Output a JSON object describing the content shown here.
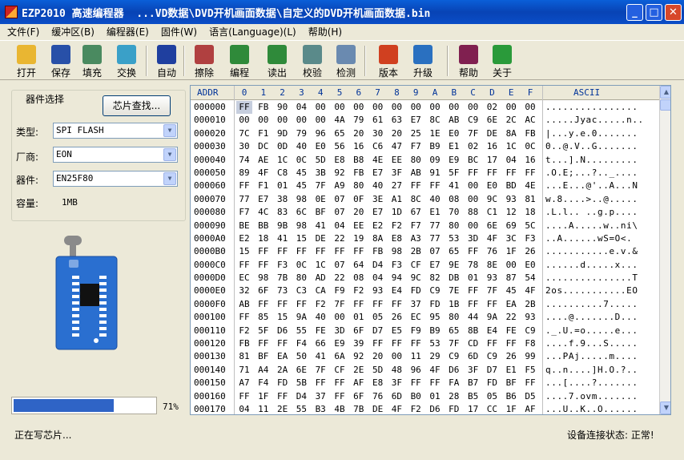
{
  "window": {
    "title": "EZP2010 高速编程器  ...VD数据\\DVD开机画面数据\\自定义的DVD开机画面数据.bin",
    "min": "_",
    "max": "□",
    "close": "✕"
  },
  "menu": [
    "文件(F)",
    "缓冲区(B)",
    "编程器(E)",
    "固件(W)",
    "语言(Language)(L)",
    "帮助(H)"
  ],
  "toolbar": {
    "items": [
      {
        "label": "打开",
        "icon": "open-folder-icon",
        "color": "#e9b632"
      },
      {
        "label": "保存",
        "icon": "floppy-save-icon",
        "color": "#2850a8"
      },
      {
        "label": "填充",
        "icon": "fill-icon",
        "color": "#4a8a60"
      },
      {
        "label": "交换",
        "icon": "swap-icon",
        "color": "#3aa0c8"
      },
      {
        "label": "自动",
        "icon": "auto-icon",
        "color": "#1f3f9f"
      },
      {
        "label": "擦除",
        "icon": "erase-icon",
        "color": "#b04040"
      },
      {
        "label": "编程",
        "icon": "program-icon",
        "color": "#2f8a3a"
      },
      {
        "label": "读出",
        "icon": "read-icon",
        "color": "#2f8a3a"
      },
      {
        "label": "校验",
        "icon": "verify-icon",
        "color": "#5a8a8a"
      },
      {
        "label": "检测",
        "icon": "detect-icon",
        "color": "#6a8ab0"
      },
      {
        "label": "版本",
        "icon": "version-icon",
        "color": "#d04020"
      },
      {
        "label": "升级",
        "icon": "upgrade-icon",
        "color": "#2a70c0"
      },
      {
        "label": "帮助",
        "icon": "help-book-icon",
        "color": "#802050"
      },
      {
        "label": "关于",
        "icon": "info-icon",
        "color": "#2a9a3a"
      }
    ]
  },
  "device": {
    "group_title": "器件选择",
    "find_chip": "芯片查找...",
    "type_label": "类型:",
    "type_value": "SPI FLASH",
    "vendor_label": "厂商:",
    "vendor_value": "EON",
    "chip_label": "器件:",
    "chip_value": "EN25F80",
    "capacity_label": "容量:",
    "capacity_value": "1MB"
  },
  "progress": {
    "value": 0.71,
    "text": "71%"
  },
  "hex": {
    "addr_header": "ADDR",
    "col_headers": [
      "0",
      "1",
      "2",
      "3",
      "4",
      "5",
      "6",
      "7",
      "8",
      "9",
      "A",
      "B",
      "C",
      "D",
      "E",
      "F"
    ],
    "ascii_header": "ASCII",
    "rows": [
      {
        "addr": "000000",
        "bytes": [
          "FF",
          "FB",
          "90",
          "04",
          "00",
          "00",
          "00",
          "00",
          "00",
          "00",
          "00",
          "00",
          "00",
          "02",
          "00",
          "00"
        ],
        "ascii": "................"
      },
      {
        "addr": "000010",
        "bytes": [
          "00",
          "00",
          "00",
          "00",
          "00",
          "4A",
          "79",
          "61",
          "63",
          "E7",
          "8C",
          "AB",
          "C9",
          "6E",
          "2C",
          "AC"
        ],
        "ascii": ".....Jyac.....n.."
      },
      {
        "addr": "000020",
        "bytes": [
          "7C",
          "F1",
          "9D",
          "79",
          "96",
          "65",
          "20",
          "30",
          "20",
          "25",
          "1E",
          "E0",
          "7F",
          "DE",
          "8A",
          "FB"
        ],
        "ascii": "|...y.e.0......."
      },
      {
        "addr": "000030",
        "bytes": [
          "30",
          "DC",
          "0D",
          "40",
          "E0",
          "56",
          "16",
          "C6",
          "47",
          "F7",
          "B9",
          "E1",
          "02",
          "16",
          "1C",
          "0C"
        ],
        "ascii": "0..@.V..G......."
      },
      {
        "addr": "000040",
        "bytes": [
          "74",
          "AE",
          "1C",
          "0C",
          "5D",
          "E8",
          "B8",
          "4E",
          "EE",
          "80",
          "09",
          "E9",
          "BC",
          "17",
          "04",
          "16"
        ],
        "ascii": "t...].N........."
      },
      {
        "addr": "000050",
        "bytes": [
          "89",
          "4F",
          "C8",
          "45",
          "3B",
          "92",
          "FB",
          "E7",
          "3F",
          "AB",
          "91",
          "5F",
          "FF",
          "FF",
          "FF",
          "FF"
        ],
        "ascii": ".O.E;...?.._...."
      },
      {
        "addr": "000060",
        "bytes": [
          "FF",
          "F1",
          "01",
          "45",
          "7F",
          "A9",
          "80",
          "40",
          "27",
          "FF",
          "FF",
          "41",
          "00",
          "E0",
          "BD",
          "4E"
        ],
        "ascii": "...E...@'..A...N"
      },
      {
        "addr": "000070",
        "bytes": [
          "77",
          "E7",
          "38",
          "98",
          "0E",
          "07",
          "0F",
          "3E",
          "A1",
          "8C",
          "40",
          "08",
          "00",
          "9C",
          "93",
          "81"
        ],
        "ascii": "w.8....>..@....."
      },
      {
        "addr": "000080",
        "bytes": [
          "F7",
          "4C",
          "83",
          "6C",
          "BF",
          "07",
          "20",
          "E7",
          "1D",
          "67",
          "E1",
          "70",
          "88",
          "C1",
          "12",
          "18"
        ],
        "ascii": ".L.l.. ..g.p...."
      },
      {
        "addr": "000090",
        "bytes": [
          "BE",
          "BB",
          "9B",
          "98",
          "41",
          "04",
          "EE",
          "E2",
          "F2",
          "F7",
          "77",
          "80",
          "00",
          "6E",
          "69",
          "5C"
        ],
        "ascii": "....A.....w..ni\\"
      },
      {
        "addr": "0000A0",
        "bytes": [
          "E2",
          "18",
          "41",
          "15",
          "DE",
          "22",
          "19",
          "8A",
          "E8",
          "A3",
          "77",
          "53",
          "3D",
          "4F",
          "3C",
          "F3"
        ],
        "ascii": "..A......wS=O<."
      },
      {
        "addr": "0000B0",
        "bytes": [
          "15",
          "FF",
          "FF",
          "FF",
          "FF",
          "FF",
          "FF",
          "FB",
          "98",
          "2B",
          "07",
          "65",
          "FF",
          "76",
          "1F",
          "26"
        ],
        "ascii": "...........e.v.&"
      },
      {
        "addr": "0000C0",
        "bytes": [
          "FF",
          "FF",
          "F3",
          "0C",
          "1C",
          "07",
          "64",
          "D4",
          "F3",
          "CF",
          "E7",
          "9E",
          "78",
          "8E",
          "00",
          "E0"
        ],
        "ascii": "......d.....x..."
      },
      {
        "addr": "0000D0",
        "bytes": [
          "EC",
          "98",
          "7B",
          "80",
          "AD",
          "22",
          "08",
          "04",
          "94",
          "9C",
          "82",
          "DB",
          "01",
          "93",
          "87",
          "54"
        ],
        "ascii": "...............T"
      },
      {
        "addr": "0000E0",
        "bytes": [
          "32",
          "6F",
          "73",
          "C3",
          "CA",
          "F9",
          "F2",
          "93",
          "E4",
          "FD",
          "C9",
          "7E",
          "FF",
          "7F",
          "45",
          "4F"
        ],
        "ascii": "2os...........EO"
      },
      {
        "addr": "0000F0",
        "bytes": [
          "AB",
          "FF",
          "FF",
          "FF",
          "F2",
          "7F",
          "FF",
          "FF",
          "FF",
          "37",
          "FD",
          "1B",
          "FF",
          "FF",
          "EA",
          "2B"
        ],
        "ascii": "..........7....."
      },
      {
        "addr": "000100",
        "bytes": [
          "FF",
          "85",
          "15",
          "9A",
          "40",
          "00",
          "01",
          "05",
          "26",
          "EC",
          "95",
          "80",
          "44",
          "9A",
          "22",
          "93"
        ],
        "ascii": "....@.......D..."
      },
      {
        "addr": "000110",
        "bytes": [
          "F2",
          "5F",
          "D6",
          "55",
          "FE",
          "3D",
          "6F",
          "D7",
          "E5",
          "F9",
          "B9",
          "65",
          "8B",
          "E4",
          "FE",
          "C9"
        ],
        "ascii": "._.U.=o.....e..."
      },
      {
        "addr": "000120",
        "bytes": [
          "FB",
          "FF",
          "FF",
          "F4",
          "66",
          "E9",
          "39",
          "FF",
          "FF",
          "FF",
          "53",
          "7F",
          "CD",
          "FF",
          "FF",
          "F8"
        ],
        "ascii": "....f.9...S....."
      },
      {
        "addr": "000130",
        "bytes": [
          "81",
          "BF",
          "EA",
          "50",
          "41",
          "6A",
          "92",
          "20",
          "00",
          "11",
          "29",
          "C9",
          "6D",
          "C9",
          "26",
          "99"
        ],
        "ascii": "...PAj.....m...."
      },
      {
        "addr": "000140",
        "bytes": [
          "71",
          "A4",
          "2A",
          "6E",
          "7F",
          "CF",
          "2E",
          "5D",
          "48",
          "96",
          "4F",
          "D6",
          "3F",
          "D7",
          "E1",
          "F5"
        ],
        "ascii": "q..n....]H.O.?.."
      },
      {
        "addr": "000150",
        "bytes": [
          "A7",
          "F4",
          "FD",
          "5B",
          "FF",
          "FF",
          "AF",
          "E8",
          "3F",
          "FF",
          "FF",
          "FA",
          "B7",
          "FD",
          "BF",
          "FF"
        ],
        "ascii": "...[....?......."
      },
      {
        "addr": "000160",
        "bytes": [
          "FF",
          "1F",
          "FF",
          "D4",
          "37",
          "FF",
          "6F",
          "76",
          "6D",
          "B0",
          "01",
          "28",
          "B5",
          "05",
          "B6",
          "D5"
        ],
        "ascii": "....7.ovm......."
      },
      {
        "addr": "000170",
        "bytes": [
          "04",
          "11",
          "2E",
          "55",
          "B3",
          "4B",
          "7B",
          "DE",
          "4F",
          "F2",
          "D6",
          "FD",
          "17",
          "CC",
          "1F",
          "AF"
        ],
        "ascii": "...U..K..O......"
      }
    ]
  },
  "status": {
    "left": "正在写芯片...",
    "right": "设备连接状态: 正常!"
  }
}
